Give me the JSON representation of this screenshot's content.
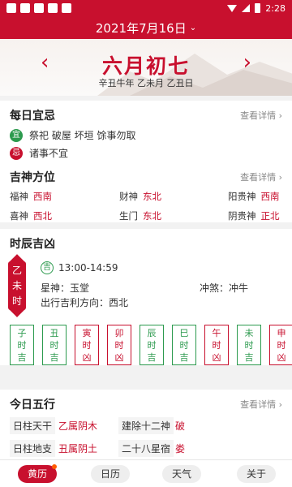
{
  "status": {
    "time": "2:28"
  },
  "header": {
    "date": "2021年7月16日"
  },
  "lunar": {
    "day": "六月初七",
    "ganzhi": "辛丑牛年 乙未月 乙丑日",
    "prev": "‹",
    "next": "›"
  },
  "yiji": {
    "title": "每日宜忌",
    "more": "查看详情 ›",
    "yi_badge": "宜",
    "yi_text": "祭祀 破屋 坏垣 馀事勿取",
    "ji_badge": "忌",
    "ji_text": "诸事不宜"
  },
  "gods": {
    "title": "吉神方位",
    "more": "查看详情 ›",
    "items": [
      {
        "name": "福神",
        "dir": "西南"
      },
      {
        "name": "财神",
        "dir": "东北"
      },
      {
        "name": "阳贵神",
        "dir": "西南"
      },
      {
        "name": "喜神",
        "dir": "西北"
      },
      {
        "name": "生门",
        "dir": "东北"
      },
      {
        "name": "阴贵神",
        "dir": "正北"
      }
    ]
  },
  "shichen": {
    "title": "时辰吉凶",
    "badge": [
      "乙",
      "未",
      "时"
    ],
    "ji_mark": "吉",
    "time_range": "13:00-14:59",
    "star_label": "星神：",
    "star": "玉堂",
    "chong_label": "冲煞：",
    "chong": "冲牛",
    "direction_label": "出行吉利方向：",
    "direction": "西北",
    "hours": [
      {
        "name": "子时",
        "luck": "吉"
      },
      {
        "name": "丑时",
        "luck": "吉"
      },
      {
        "name": "寅时",
        "luck": "凶"
      },
      {
        "name": "卯时",
        "luck": "凶"
      },
      {
        "name": "辰时",
        "luck": "吉"
      },
      {
        "name": "巳时",
        "luck": "吉"
      },
      {
        "name": "午时",
        "luck": "凶"
      },
      {
        "name": "未时",
        "luck": "吉"
      },
      {
        "name": "申时",
        "luck": "凶"
      }
    ]
  },
  "wuxing": {
    "title": "今日五行",
    "more": "查看详情 ›",
    "rows": [
      {
        "label": "日柱天干",
        "value": "乙属阴木",
        "label2": "建除十二神",
        "value2": "破"
      },
      {
        "label": "日柱地支",
        "value": "丑属阴土",
        "label2": "二十八星宿",
        "value2": "娄"
      }
    ]
  },
  "nav": {
    "items": [
      "黄历",
      "日历",
      "天气",
      "关于"
    ]
  },
  "colors": {
    "brand": "#c8102e",
    "good": "#2c9a4e"
  }
}
